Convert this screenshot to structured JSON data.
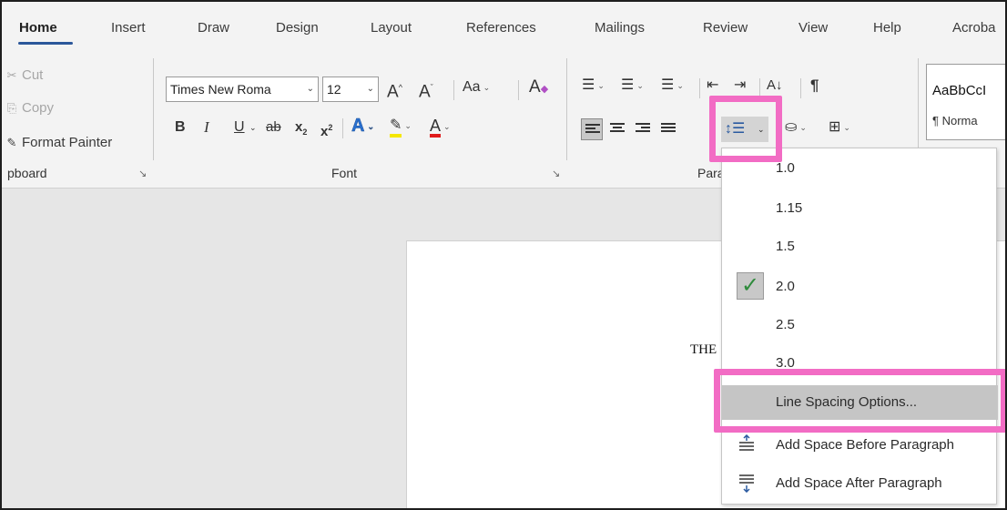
{
  "tabs": [
    {
      "label": "Home",
      "active": true
    },
    {
      "label": "Insert"
    },
    {
      "label": "Draw"
    },
    {
      "label": "Design"
    },
    {
      "label": "Layout"
    },
    {
      "label": "References"
    },
    {
      "label": "Mailings"
    },
    {
      "label": "Review"
    },
    {
      "label": "View"
    },
    {
      "label": "Help"
    },
    {
      "label": "Acroba"
    }
  ],
  "clipboard": {
    "cut": "Cut",
    "copy": "Copy",
    "format_painter": "Format Painter",
    "label": "pboard",
    "launcher": "↘"
  },
  "font": {
    "font_name": "Times New Roma",
    "font_size": "12",
    "grow": "A",
    "shrink": "A",
    "change_case": "Aa",
    "clear_format": "A",
    "bold": "B",
    "italic": "I",
    "underline": "U",
    "strikethrough": "ab",
    "subscript": "x",
    "superscript": "x",
    "text_effects": "A",
    "highlight": "🖊",
    "font_color": "A",
    "label": "Font",
    "launcher": "↘"
  },
  "paragraph": {
    "label": "Para",
    "sort": "A↓",
    "show_marks": "¶"
  },
  "styles": {
    "preview": "AaBbCcI",
    "normal": "¶ Norma"
  },
  "document": {
    "text": "THE"
  },
  "line_spacing_menu": {
    "options": [
      "1.0",
      "1.15",
      "1.5",
      "2.0",
      "2.5",
      "3.0"
    ],
    "selected": "2.0",
    "line_spacing_options": "Line Spacing Options...",
    "add_space_before": "Add Space Before Paragraph",
    "add_space_after": "Add Space After Paragraph"
  },
  "colors": {
    "accent": "#2b579a",
    "highlight_annotation": "#f26cc4",
    "check": "#2e8b3c",
    "highlight_yellow": "#f5e700",
    "font_red": "#e01b1b"
  }
}
